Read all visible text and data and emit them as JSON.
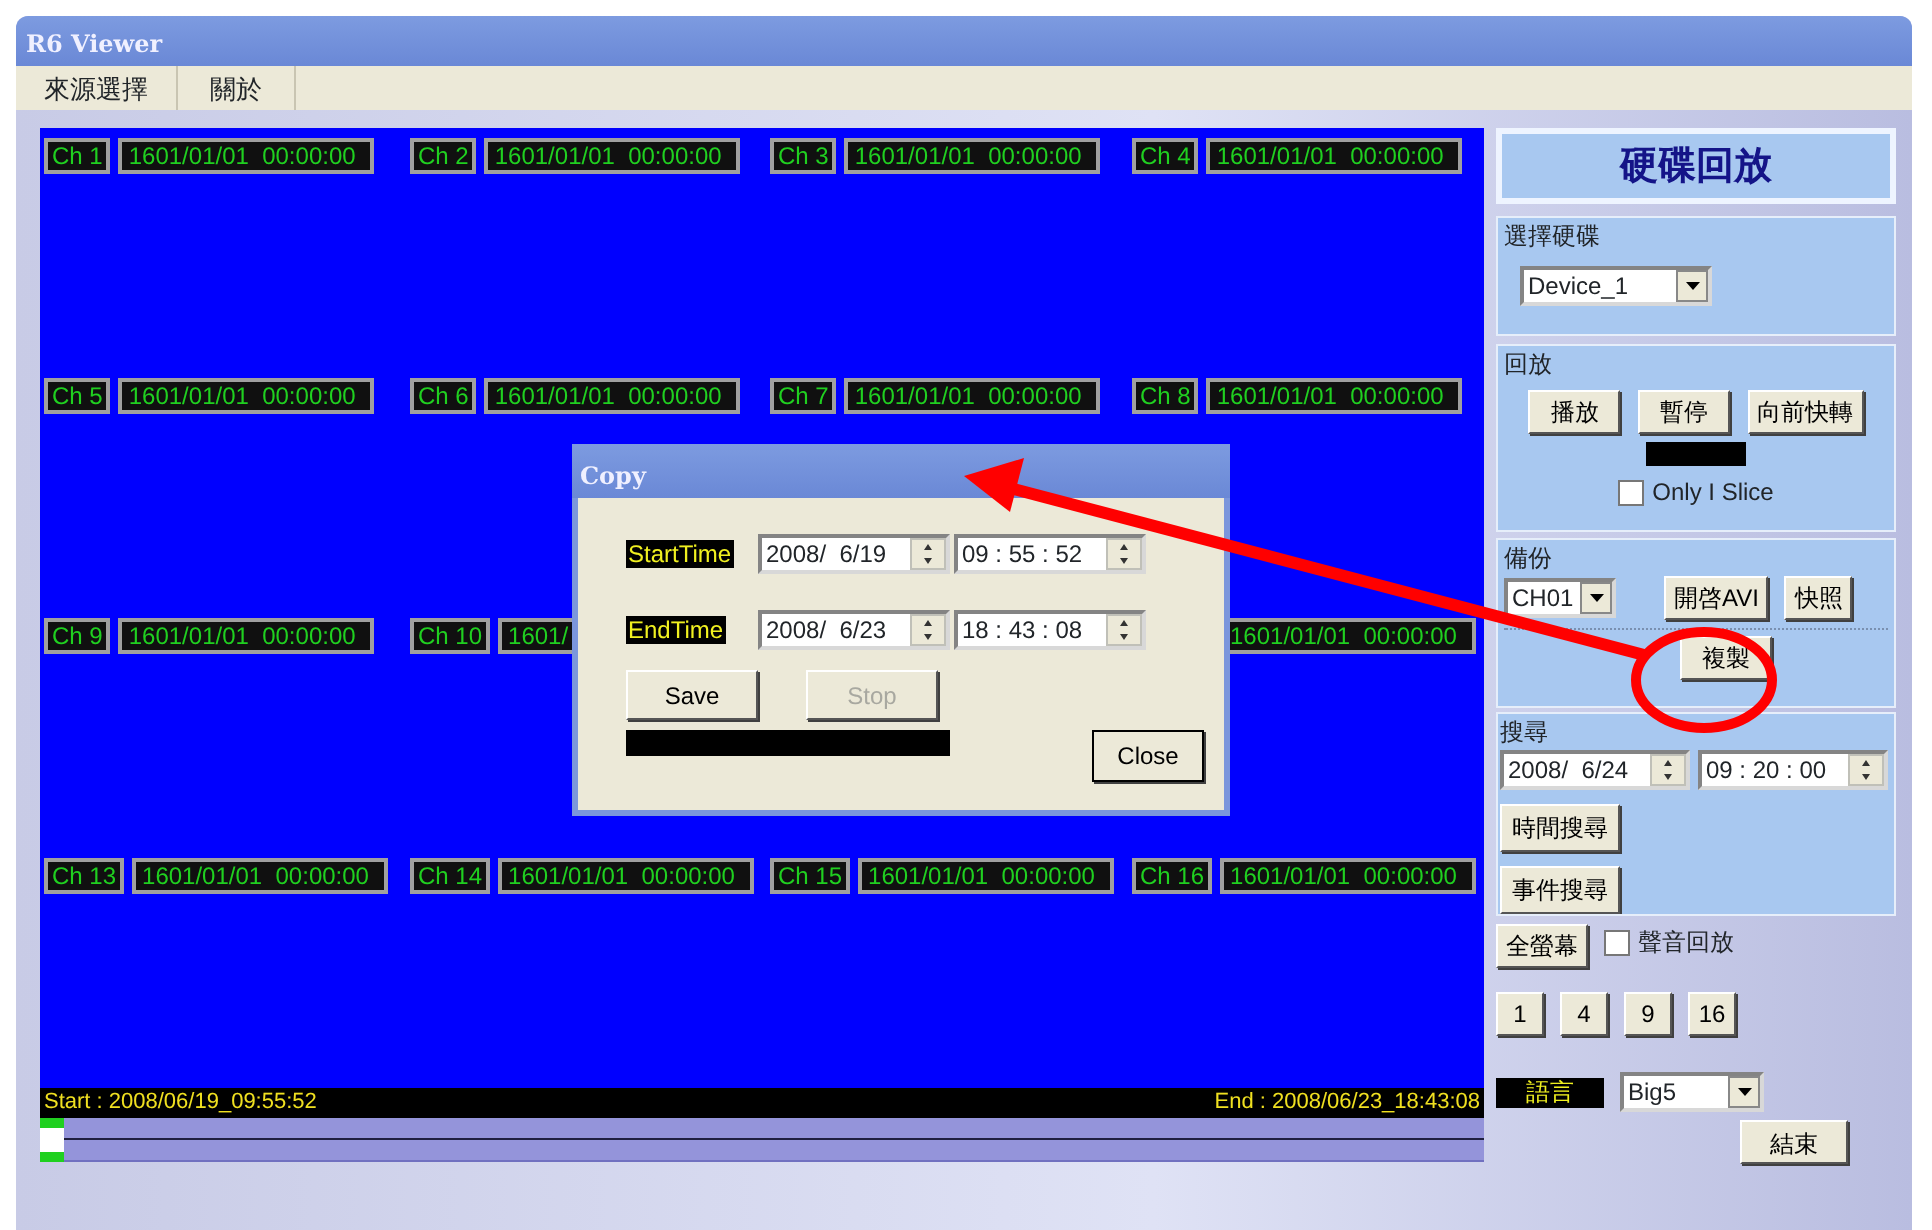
{
  "window": {
    "title": "R6 Viewer"
  },
  "menu": [
    {
      "label": "來源選擇"
    },
    {
      "label": "關於"
    }
  ],
  "video_rows": [
    {
      "cells": [
        {
          "label": "Ch 1",
          "time": "1601/01/01  00:00:00"
        },
        {
          "label": "Ch 2",
          "time": "1601/01/01  00:00:00"
        },
        {
          "label": "Ch 3",
          "time": "1601/01/01  00:00:00"
        },
        {
          "label": "Ch 4",
          "time": "1601/01/01  00:00:00"
        }
      ]
    },
    {
      "cells": [
        {
          "label": "Ch 5",
          "time": "1601/01/01  00:00:00"
        },
        {
          "label": "Ch 6",
          "time": "1601/01/01  00:00:00"
        },
        {
          "label": "Ch 7",
          "time": "1601/01/01  00:00:00"
        },
        {
          "label": "Ch 8",
          "time": "1601/01/01  00:00:00"
        }
      ]
    },
    {
      "cells": [
        {
          "label": "Ch 9",
          "time": "1601/01/01  00:00:00"
        },
        {
          "label": "Ch 10",
          "time": "1601/"
        },
        null,
        {
          "time": "1601/01/01  00:00:00"
        }
      ]
    },
    {
      "cells": [
        {
          "label": "Ch 13",
          "time": "1601/01/01  00:00:00"
        },
        {
          "label": "Ch 14",
          "time": "1601/01/01  00:00:00"
        },
        {
          "label": "Ch 15",
          "time": "1601/01/01  00:00:00"
        },
        {
          "label": "Ch 16",
          "time": "1601/01/01  00:00:00"
        }
      ]
    }
  ],
  "status": {
    "start": "Start : 2008/06/19_09:55:52",
    "end": "End : 2008/06/23_18:43:08"
  },
  "timeline": {
    "level": 0
  },
  "panel": {
    "title": "硬碟回放",
    "disk": {
      "legend": "選擇硬碟",
      "value": "Device_1"
    },
    "playback": {
      "legend": "回放",
      "buttons": [
        "播放",
        "暫停",
        "向前快轉"
      ],
      "only_i_slice": {
        "label": "Only I Slice",
        "checked": false
      }
    },
    "backup": {
      "legend": "備份",
      "channel": "CH01",
      "buttons": [
        "開啓AVI",
        "快照"
      ],
      "copy_button": "複製"
    },
    "search": {
      "legend": "搜尋",
      "date": "2008/  6/24",
      "time": "09 : 20 : 00",
      "buttons": [
        "時間搜尋",
        "事件搜尋"
      ]
    },
    "fullscreen": "全螢幕",
    "audio": {
      "label": "聲音回放",
      "checked": false
    },
    "layouts": [
      "1",
      "4",
      "9",
      "16"
    ],
    "language": {
      "label": "語言",
      "value": "Big5"
    },
    "exit": "結束"
  },
  "dialog": {
    "title": "Copy",
    "rows": [
      {
        "label": "StartTime",
        "date": "2008/  6/19",
        "time": "09 : 55 : 52"
      },
      {
        "label": "EndTime",
        "date": "2008/  6/23",
        "time": "18 : 43 : 08"
      }
    ],
    "save": {
      "label": "Save",
      "disabled": false
    },
    "stop": {
      "label": "Stop",
      "disabled": true
    },
    "progress": {
      "level": 0
    },
    "close": "Close"
  }
}
